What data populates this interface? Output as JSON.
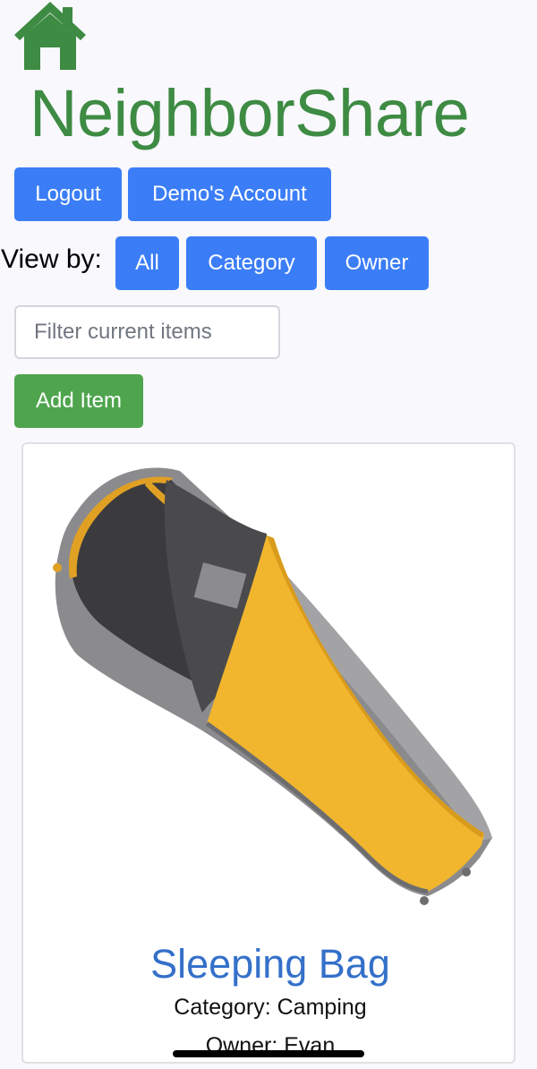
{
  "brand": {
    "title": "NeighborShare",
    "accent_color": "#3e8b43"
  },
  "header": {
    "home_icon": "home-icon",
    "logout_label": "Logout",
    "account_label": "Demo's Account"
  },
  "view_by": {
    "label": "View by:",
    "options": [
      "All",
      "Category",
      "Owner"
    ]
  },
  "filter": {
    "placeholder": "Filter current items",
    "value": ""
  },
  "add_item_label": "Add Item",
  "items": [
    {
      "name": "Sleeping Bag",
      "category": "Category: Camping",
      "owner": "Owner: Evan",
      "image": "sleeping-bag-image"
    }
  ],
  "colors": {
    "primary_button": "#3b7df6",
    "success_button": "#4fa54e",
    "link": "#3470c9",
    "background": "#f8f8fd"
  }
}
